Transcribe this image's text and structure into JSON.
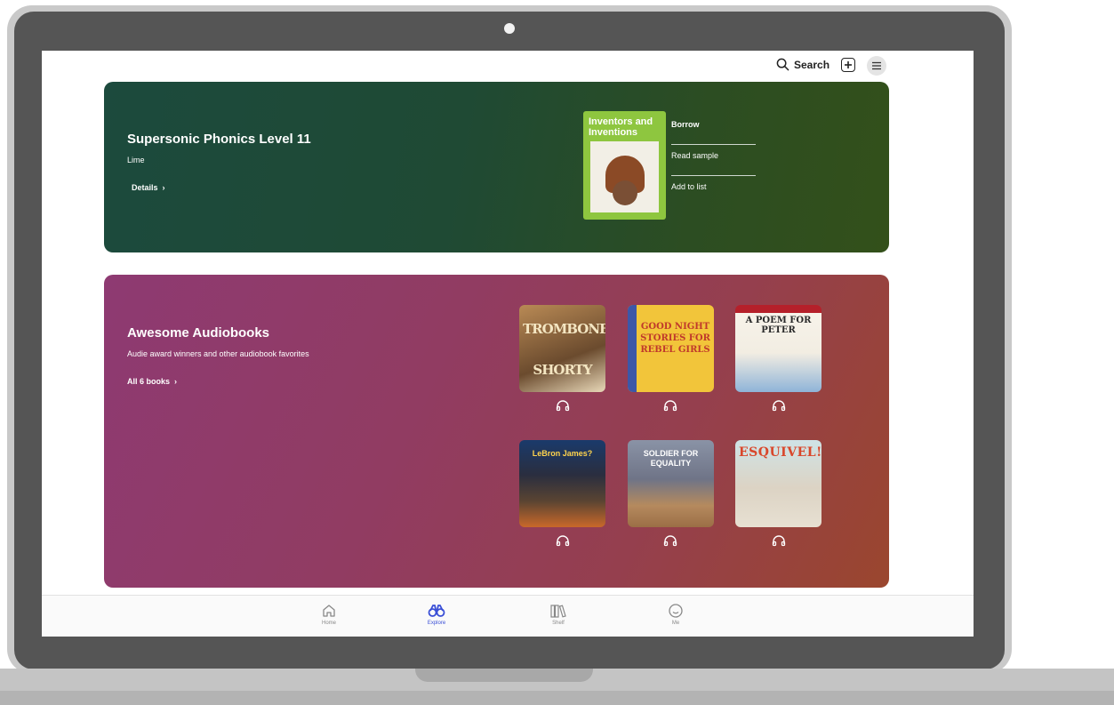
{
  "header": {
    "search_label": "Search",
    "add_icon": "plus-square-icon",
    "menu_icon": "hamburger-menu-icon"
  },
  "featured": {
    "title": "Supersonic Phonics Level 11",
    "subtitle": "Lime",
    "details_label": "Details",
    "cover_title": "Inventors and Inventions",
    "cover_color": "#8ec63f",
    "actions": [
      {
        "label": "Borrow",
        "primary": true
      },
      {
        "label": "Read sample",
        "primary": false
      },
      {
        "label": "Add to list",
        "primary": false
      }
    ]
  },
  "collection": {
    "title": "Awesome Audiobooks",
    "subtitle": "Audie award winners and other audiobook favorites",
    "link_label": "All 6 books",
    "books": [
      {
        "title": "TROMBONE SHORTY",
        "format_icon": "headphones-icon"
      },
      {
        "title": "GOOD NIGHT STORIES FOR REBEL GIRLS",
        "format_icon": "headphones-icon"
      },
      {
        "title": "A POEM FOR PETER",
        "format_icon": "headphones-icon"
      },
      {
        "title": "LeBron James?",
        "format_icon": "headphones-icon"
      },
      {
        "title": "SOLDIER FOR EQUALITY",
        "format_icon": "headphones-icon"
      },
      {
        "title": "ESQUIVEL!",
        "format_icon": "headphones-icon"
      }
    ]
  },
  "nav": {
    "items": [
      {
        "label": "Home",
        "icon": "home-icon",
        "active": false
      },
      {
        "label": "Explore",
        "icon": "binoculars-icon",
        "active": true
      },
      {
        "label": "Shelf",
        "icon": "books-icon",
        "active": false
      },
      {
        "label": "Me",
        "icon": "smiley-icon",
        "active": false
      }
    ]
  },
  "colors": {
    "accent": "#3a4fd6",
    "featured_banner": "#1f4a34",
    "collection_banner": "#913c62"
  }
}
